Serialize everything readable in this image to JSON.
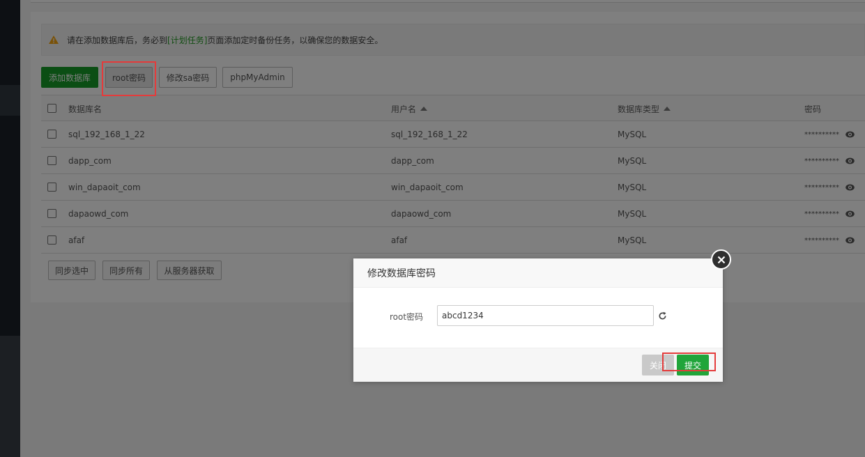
{
  "alert": {
    "prefix": "请在添加数据库后，务必到",
    "link": "[计划任务]",
    "suffix": "页面添加定时备份任务，以确保您的数据安全。"
  },
  "toolbar": {
    "add_db": "添加数据库",
    "root_pwd": "root密码",
    "sa_pwd": "修改sa密码",
    "phpmyadmin": "phpMyAdmin"
  },
  "table": {
    "headers": {
      "name": "数据库名",
      "user": "用户名",
      "type": "数据库类型",
      "password": "密码"
    },
    "rows": [
      {
        "name": "sql_192_168_1_22",
        "user": "sql_192_168_1_22",
        "type": "MySQL",
        "password": "**********"
      },
      {
        "name": "dapp_com",
        "user": "dapp_com",
        "type": "MySQL",
        "password": "**********"
      },
      {
        "name": "win_dapaoit_com",
        "user": "win_dapaoit_com",
        "type": "MySQL",
        "password": "**********"
      },
      {
        "name": "dapaowd_com",
        "user": "dapaowd_com",
        "type": "MySQL",
        "password": "**********"
      },
      {
        "name": "afaf",
        "user": "afaf",
        "type": "MySQL",
        "password": "**********"
      }
    ]
  },
  "bottom_actions": {
    "sync_selected": "同步选中",
    "sync_all": "同步所有",
    "fetch_server": "从服务器获取"
  },
  "modal": {
    "title": "修改数据库密码",
    "field_label": "root密码",
    "field_value": "abcd1234",
    "close_label": "关闭",
    "submit_label": "提交"
  },
  "colors": {
    "accent_green": "#20a53a",
    "highlight_red": "#e43b3b"
  }
}
